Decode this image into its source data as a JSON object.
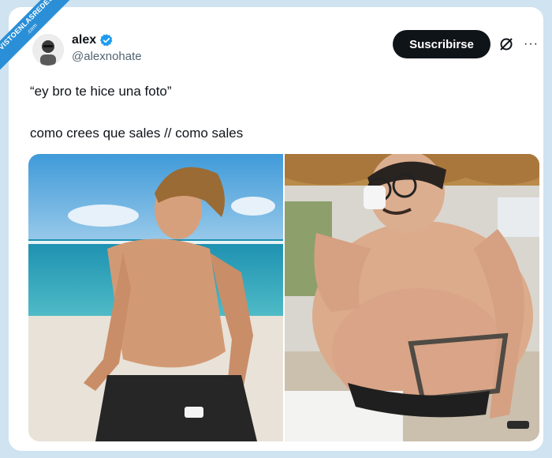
{
  "watermark": {
    "text": "VISTOENLASREDES",
    "sub": ".com"
  },
  "tweet": {
    "display_name": "alex",
    "handle": "@alexnohate",
    "subscribe_label": "Suscribirse",
    "more_label": "···",
    "text_line1": "“ey bro te hice una foto”",
    "text_line2": "como crees que sales // como sales"
  },
  "colors": {
    "verified": "#1d9bf0",
    "button": "#0f1419",
    "background": "#cfe3f1",
    "watermark": "#2a8fd6"
  },
  "icons": {
    "verified": "verified-badge-icon",
    "grok": "grok-icon",
    "more": "more-icon"
  },
  "media": [
    {
      "name": "left-photo",
      "description_icon": "photo"
    },
    {
      "name": "right-photo",
      "description_icon": "photo"
    }
  ]
}
